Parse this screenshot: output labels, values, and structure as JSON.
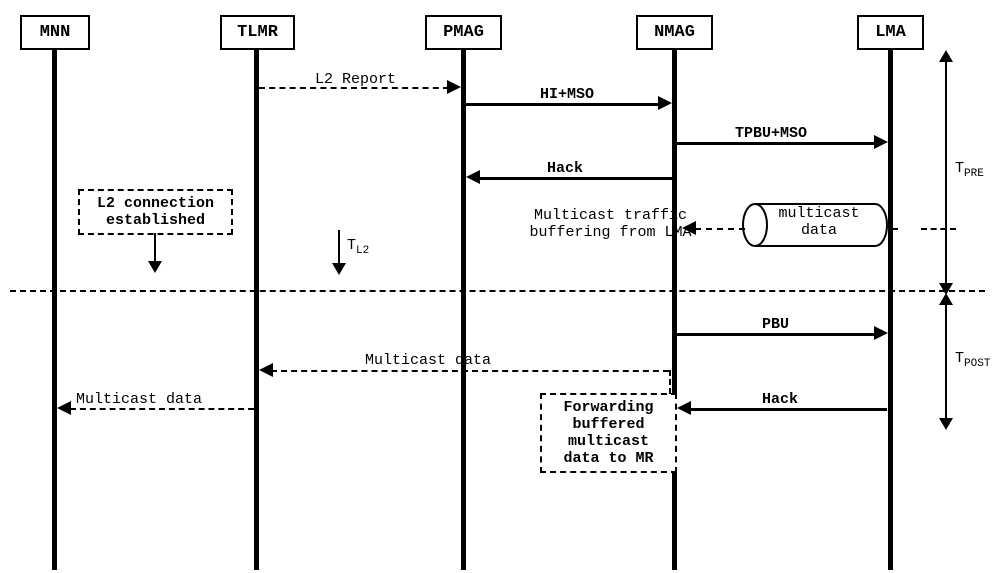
{
  "actors": {
    "mnn": "MNN",
    "tlmr": "TLMR",
    "pmag": "PMAG",
    "nmag": "NMAG",
    "lma": "LMA"
  },
  "messages": {
    "l2_report": "L2 Report",
    "hi_mso": "HI+MSO",
    "tpbu_mso": "TPBU+MSO",
    "hack1": "Hack",
    "l2_conn": "L2 connection established",
    "t_l2": "T",
    "t_l2_sub": "L2",
    "multicast_buffering": "Multicast traffic buffering from LMA",
    "multicast_data_cyl": "multicast data",
    "pbu": "PBU",
    "multicast_data_arrow": "Multicast data",
    "hack2": "Hack",
    "forwarding_box": "Forwarding buffered multicast data to MR",
    "multicast_data_final": "Multicast data"
  },
  "timing": {
    "t_pre": "T",
    "t_pre_sub": "PRE",
    "t_post": "T",
    "t_post_sub": "POST"
  }
}
